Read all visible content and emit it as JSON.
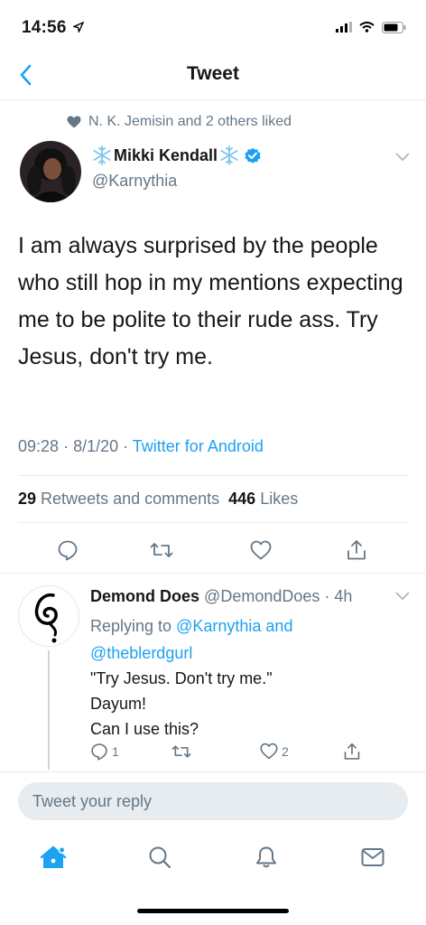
{
  "status_bar": {
    "time": "14:56"
  },
  "nav": {
    "title": "Tweet"
  },
  "liked_by": "N. K. Jemisin and 2 others liked",
  "tweet": {
    "author_name": "Mikki Kendall",
    "author_handle": "@Karnythia",
    "text": "I am always surprised by the people who still hop in my mentions expecting me to be polite to their rude ass. Try Jesus, don't try me.",
    "time": "09:28",
    "date": "8/1/20",
    "source": "Twitter for Android",
    "retweets_count": "29",
    "retweets_label": "Retweets and comments",
    "likes_count": "446",
    "likes_label": "Likes"
  },
  "reply": {
    "author_name": "Demond Does",
    "author_handle": "@DemondDoes",
    "age": "4h",
    "replying_prefix": "Replying to",
    "replying_user1": "@Karnythia",
    "replying_and": "and",
    "replying_user2": "@theblerdgurl",
    "line1": "\"Try Jesus.  Don't try me.\"",
    "line2": "Dayum!",
    "line3": "Can I use this?",
    "reply_count": "1",
    "like_count": "2"
  },
  "composer": {
    "placeholder": "Tweet your reply"
  },
  "colors": {
    "accent": "#1da1f2",
    "muted": "#657786",
    "verified": "#1da1f2"
  },
  "icons": [
    "back-chevron-icon",
    "heart-small-icon",
    "snowflake-icon",
    "verified-badge-icon",
    "chevron-down-icon",
    "reply-icon",
    "retweet-icon",
    "like-icon",
    "share-icon",
    "home-icon",
    "search-icon",
    "notifications-icon",
    "messages-icon"
  ]
}
